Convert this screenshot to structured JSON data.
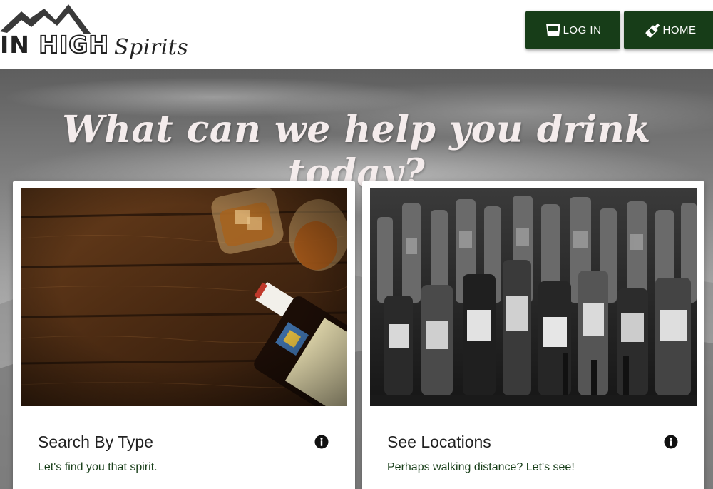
{
  "header": {
    "logo": {
      "main_left": "IN ",
      "main_right": "HIGH",
      "script": "Spirits"
    },
    "nav": {
      "login_label": "LOG IN",
      "login_icon": "glass-icon",
      "home_label": "HOME",
      "home_icon": "bottle-icon"
    }
  },
  "hero": {
    "title": "What can we help you drink today?"
  },
  "cards": [
    {
      "title": "Search By Type",
      "subtitle": "Let's find you that spirit.",
      "image": "whiskey-bottle-on-wood-photo",
      "icon": "info-icon"
    },
    {
      "title": "See Locations",
      "subtitle": "Perhaps walking distance? Let's see!",
      "image": "bar-shelf-bottles-photo",
      "icon": "info-icon"
    }
  ],
  "colors": {
    "nav_button_bg": "#173d18",
    "subtitle_text": "#173d18",
    "hero_title": "#f4ecec"
  }
}
